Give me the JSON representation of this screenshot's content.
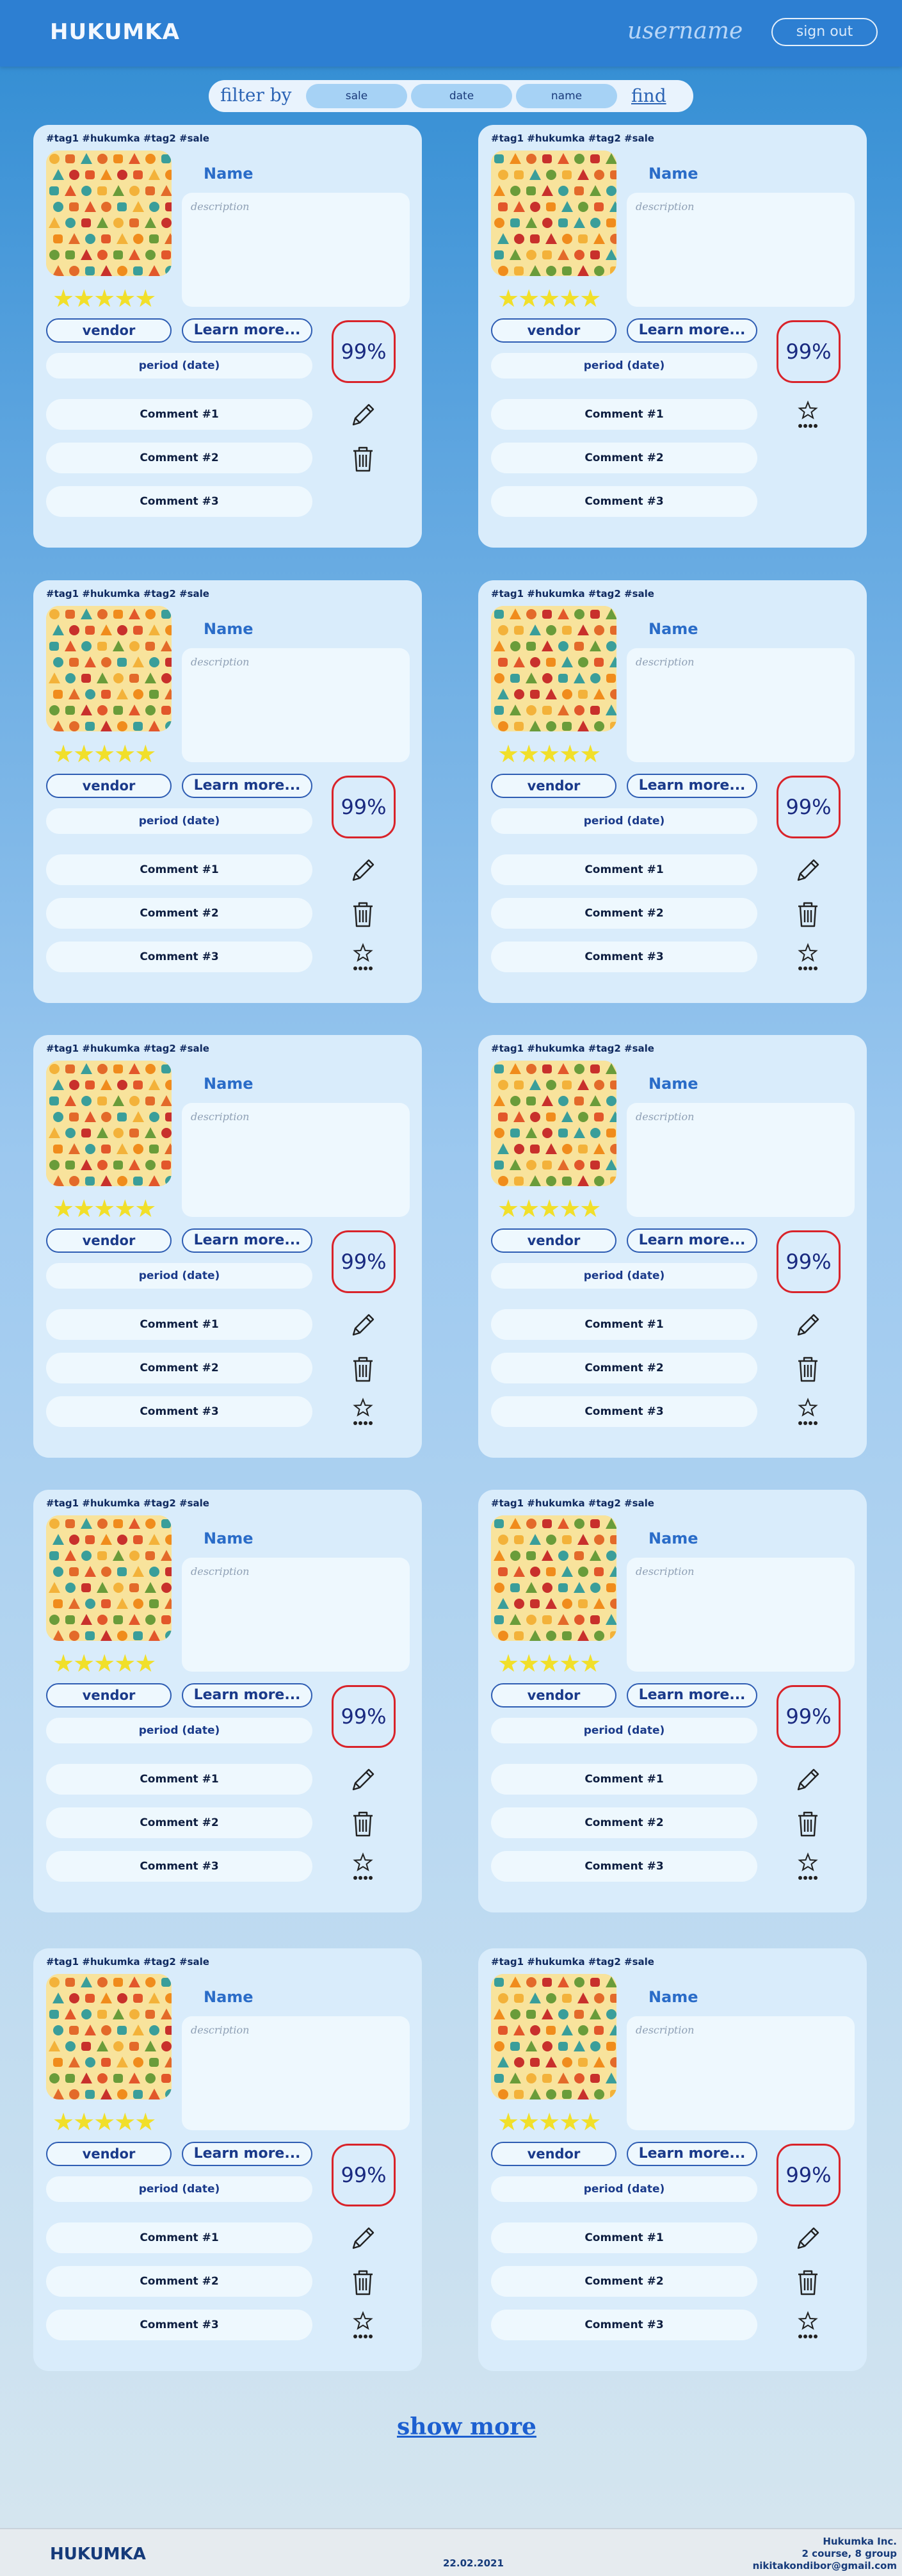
{
  "header": {
    "logo": "HUKUMKA",
    "username": "username",
    "sign_out": "sign out"
  },
  "filter": {
    "label": "filter by",
    "options": [
      "sale",
      "date",
      "name"
    ],
    "find": "find"
  },
  "card": {
    "tags": "#tag1 #hukumka #tag2 #sale",
    "name": "Name",
    "description_placeholder": "description",
    "rating": "★★★★★",
    "vendor": "vendor",
    "learn_more": "Learn more...",
    "percent": "99%",
    "period": "period (date)",
    "comments": [
      "Comment #1",
      "Comment #2",
      "Comment #3"
    ]
  },
  "show_more": "show more",
  "footer": {
    "logo": "HUKUMKA",
    "date": "22.02.2021",
    "company": "Hukumka Inc.",
    "group": "2 course, 8 group",
    "email": "nikitakondibor@gmail.com"
  },
  "colors": {
    "header": "#2d7fd2",
    "card": "#d9ecfb",
    "accent": "#2a6cc8",
    "percent_border": "#d9232a",
    "stars": "#f1df2a"
  },
  "cards_count": 10
}
